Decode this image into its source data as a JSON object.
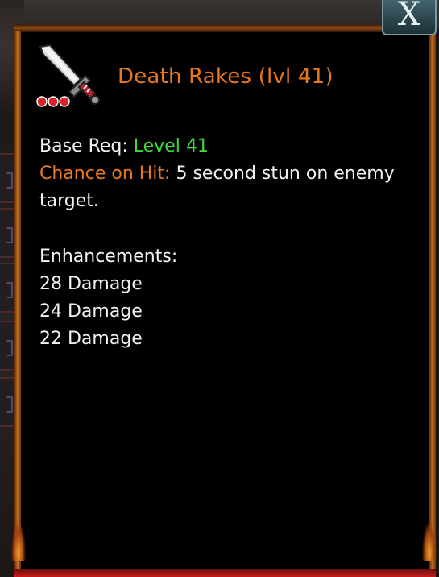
{
  "item": {
    "title": "Death Rakes (lvl 41)",
    "icon": "sword-icon",
    "rarity_gems": 3
  },
  "close_button": {
    "label": "X"
  },
  "requirements": {
    "base_req_label": "Base Req:",
    "base_req_value": "Level 41",
    "chance_label": "Chance on Hit:",
    "chance_value": "5 second stun on enemy",
    "chance_value_cont": "target."
  },
  "enhancements": {
    "header": "Enhancements:",
    "items": [
      "28 Damage",
      "24 Damage",
      "22 Damage"
    ]
  },
  "colors": {
    "title": "#e8781e",
    "highlight_green": "#3ed83e",
    "text": "#f2f2f2",
    "panel_bg": "#000000"
  }
}
